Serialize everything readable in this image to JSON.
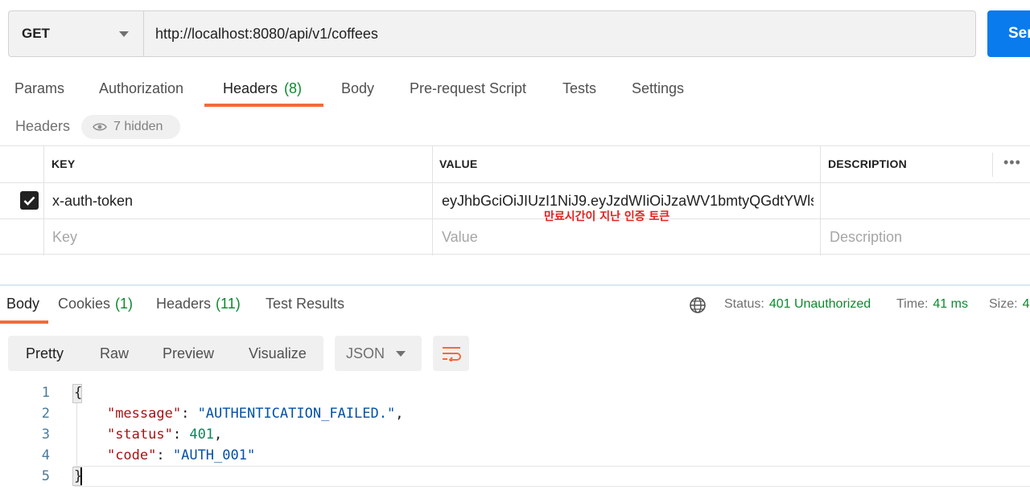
{
  "request": {
    "method": "GET",
    "url": "http://localhost:8080/api/v1/coffees",
    "send_label": "Send"
  },
  "req_tabs": [
    {
      "label": "Params"
    },
    {
      "label": "Authorization"
    },
    {
      "label": "Headers",
      "count": "(8)"
    },
    {
      "label": "Body"
    },
    {
      "label": "Pre-request Script"
    },
    {
      "label": "Tests"
    },
    {
      "label": "Settings"
    }
  ],
  "headers_section": {
    "label": "Headers",
    "hidden": "7 hidden"
  },
  "table": {
    "columns": [
      "KEY",
      "VALUE",
      "DESCRIPTION"
    ],
    "more": "•••",
    "rows": [
      {
        "checked": true,
        "key": "x-auth-token",
        "value": "eyJhbGciOiJIUzI1NiJ9.eyJzdWIiOiJzaWV1bmtyQGdtYWlsL...",
        "description": ""
      }
    ],
    "placeholders": {
      "key": "Key",
      "value": "Value",
      "description": "Description"
    }
  },
  "annotation": "만료시간이 지난 인증 토큰",
  "response": {
    "tabs": [
      {
        "label": "Body"
      },
      {
        "label": "Cookies",
        "count": "(1)"
      },
      {
        "label": "Headers",
        "count": "(11)"
      },
      {
        "label": "Test Results"
      }
    ],
    "status": {
      "label": "Status:",
      "value": "401 Unauthorized"
    },
    "time": {
      "label": "Time:",
      "value": "41 ms"
    },
    "size": {
      "label": "Size:",
      "value": "4"
    },
    "modes": [
      "Pretty",
      "Raw",
      "Preview",
      "Visualize"
    ],
    "format": "JSON",
    "line_numbers": [
      "1",
      "2",
      "3",
      "4",
      "5"
    ],
    "code": {
      "open": "{",
      "message_key": "\"message\"",
      "message_val": "\"AUTHENTICATION_FAILED.\"",
      "status_key": "\"status\"",
      "status_val": "401",
      "code_key": "\"code\"",
      "code_val": "\"AUTH_001\"",
      "close": "}"
    }
  },
  "colors": {
    "accent": "#f26b3a",
    "send": "#097bed",
    "ok_green": "#0b8a2e",
    "annotation": "#e3201b"
  }
}
